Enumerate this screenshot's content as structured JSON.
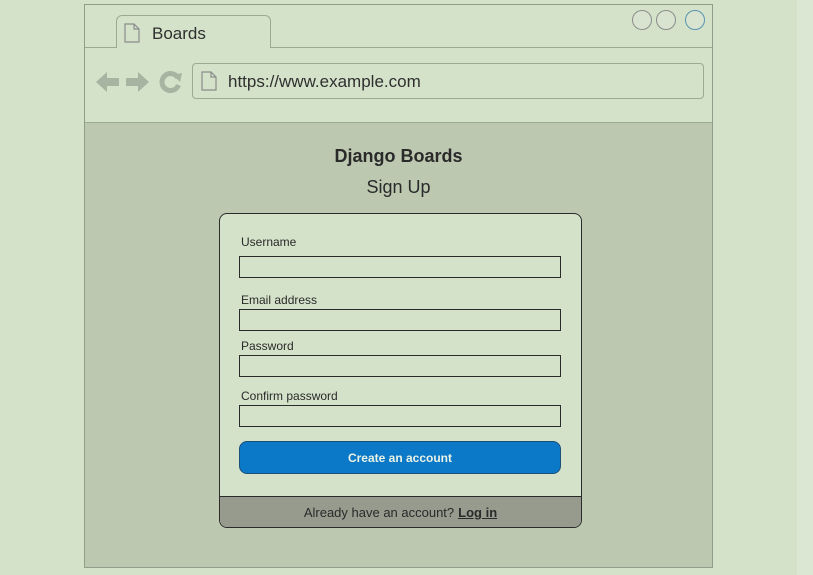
{
  "browser": {
    "tab_label": "Boards",
    "url": "https://www.example.com"
  },
  "page": {
    "site_title": "Django Boards",
    "heading": "Sign Up"
  },
  "form": {
    "fields": [
      {
        "label": "Username",
        "value": ""
      },
      {
        "label": "Email address",
        "value": ""
      },
      {
        "label": "Password",
        "value": ""
      },
      {
        "label": "Confirm password",
        "value": ""
      }
    ],
    "submit_label": "Create an account"
  },
  "footer": {
    "prompt": "Already have an account?",
    "link_label": "Log in"
  },
  "colors": {
    "background": "#d3e2c9",
    "content_area": "#bcc9b0",
    "primary_button": "#0c78c8",
    "footer": "#969b8e"
  }
}
